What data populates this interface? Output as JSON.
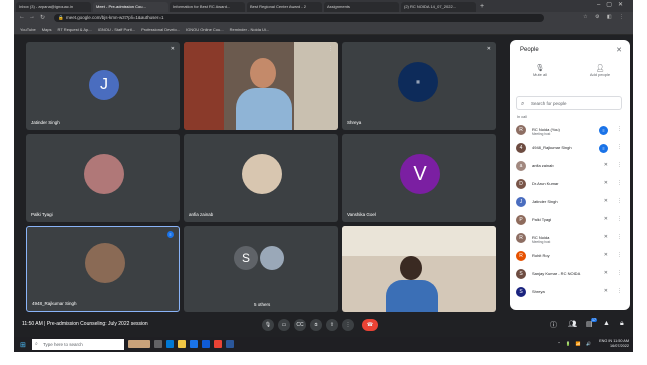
{
  "browser": {
    "tabs": [
      {
        "label": "Inbox (3) - arpana@ignouac.in"
      },
      {
        "label": "Meet - Pre-admission Cou..."
      },
      {
        "label": "Information for Best RC Award..."
      },
      {
        "label": "Best Regional Center Award - 2"
      },
      {
        "label": "Assignments"
      },
      {
        "label": "(2) RC NOIDA 14_07_2022..."
      }
    ],
    "address": "meet.google.com/bjs-kmn-wzt?pli=1&authuser=1",
    "bookmarks": [
      "YouTube",
      "Maps",
      "RT Request & Ap...",
      "IGNOU - Staff Portl...",
      "Professional Develo...",
      "IGNOU Online Cou...",
      "Reminder - Noida Ui..."
    ]
  },
  "meet": {
    "tiles": [
      {
        "name": "Jatinder Singh",
        "initial": "J",
        "color": "#4a6dbf"
      },
      {
        "name": "",
        "initial": "",
        "color": ""
      },
      {
        "name": "Shreya",
        "initial": "",
        "color": ""
      },
      {
        "name": "Palki Tyagi",
        "initial": "",
        "color": ""
      },
      {
        "name": "anfia zainab",
        "initial": "",
        "color": ""
      },
      {
        "name": "Vanshika Goel",
        "initial": "V",
        "color": "#7b1fa2"
      },
      {
        "name": "4948_Rajkumar Singh",
        "initial": "",
        "color": ""
      },
      {
        "name": "5 others",
        "initial": "S",
        "color": "#5f6368"
      },
      {
        "name": "",
        "initial": "",
        "color": ""
      }
    ],
    "meeting_info": "11:50 AM  |  Pre-admission Counseling: July 2022 session",
    "participants_badge": "17"
  },
  "people": {
    "title": "People",
    "mute_all": "Mute all",
    "add_people": "Add people",
    "search_placeholder": "Search for people",
    "in_call": "In call",
    "list": [
      {
        "name": "RC Noida (You)",
        "sub": "Meeting host",
        "initial": "R",
        "color": "#8d6e63"
      },
      {
        "name": "4948_Rajkumar Singh",
        "sub": "",
        "initial": "4",
        "color": "#6d4c41"
      },
      {
        "name": "anfia zainab",
        "sub": "",
        "initial": "a",
        "color": "#a1887f"
      },
      {
        "name": "Dr.Arun Kumar",
        "sub": "",
        "initial": "D",
        "color": "#795548"
      },
      {
        "name": "Jatinder Singh",
        "sub": "",
        "initial": "J",
        "color": "#4a6dbf"
      },
      {
        "name": "Palki Tyagi",
        "sub": "",
        "initial": "P",
        "color": "#8e6b5c"
      },
      {
        "name": "RC Noida",
        "sub": "Meeting host",
        "initial": "R",
        "color": "#8d6e63"
      },
      {
        "name": "Rohit Roy",
        "sub": "",
        "initial": "R",
        "color": "#e65100"
      },
      {
        "name": "Sanjay Kumar - RC NOIDA",
        "sub": "",
        "initial": "S",
        "color": "#6d4c41"
      },
      {
        "name": "Shreya",
        "sub": "",
        "initial": "S",
        "color": "#1a237e"
      }
    ]
  },
  "taskbar": {
    "search_placeholder": "Type here to search",
    "time": "11:50 AM",
    "date": "16/07/2022",
    "lang": "ENG IN"
  }
}
